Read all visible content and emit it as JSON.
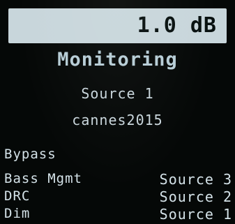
{
  "header": {
    "level": "1.0 dB"
  },
  "title": "Monitoring",
  "source": "Source 1",
  "name": "cannes2015",
  "menu": {
    "left": [
      "Bypass",
      "Bass Mgmt",
      "DRC",
      "Dim"
    ],
    "right": [
      "Source 3",
      "Source 2",
      "Source 1"
    ]
  },
  "colors": {
    "header_bg": "#c8d6db",
    "text": "#d4e2e8",
    "title": "#b7cdd6",
    "background": "#050807"
  }
}
